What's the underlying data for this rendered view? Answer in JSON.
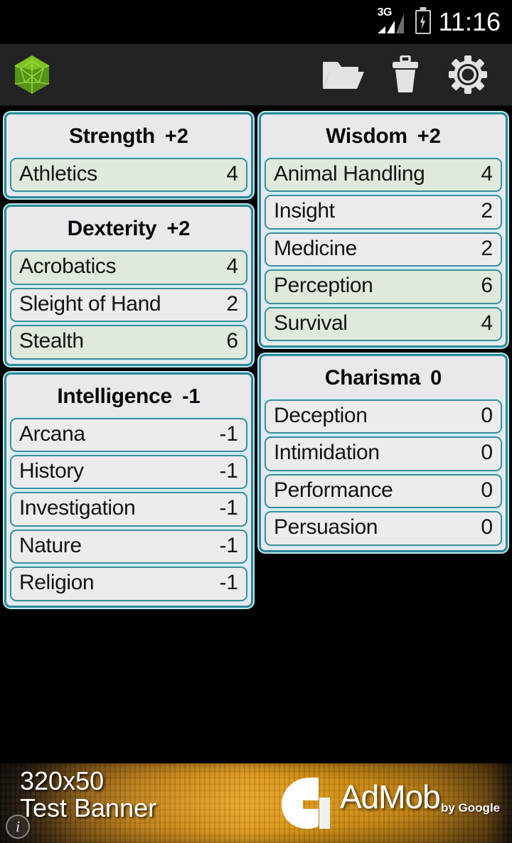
{
  "status_bar": {
    "network_label": "3G",
    "signal_icon": "signal-bars-icon",
    "battery_icon": "battery-charging-icon",
    "time": "11:16"
  },
  "action_bar": {
    "app_logo_icon": "d20-dice-icon",
    "app_logo_color": "#6aad1e",
    "buttons": [
      {
        "name": "open-folder-button",
        "icon": "folder-open-icon",
        "label": "Open"
      },
      {
        "name": "delete-button",
        "icon": "trash-icon",
        "label": "Delete"
      },
      {
        "name": "settings-button",
        "icon": "gear-icon",
        "label": "Settings"
      }
    ]
  },
  "theme": {
    "background": "#000000",
    "action_bar_bg": "#232323",
    "card_border": "#2c8a9a",
    "card_glow": "#bfe9f0",
    "card_header_bg": "#e9e8ec",
    "row_bg": "#edebeb",
    "row_proficient_bg": "#dfeadd",
    "row_border": "#3f8d9b",
    "text": "#141414"
  },
  "columns": [
    {
      "name": "left-column",
      "cards": [
        {
          "ability": "Strength",
          "modifier": "+2",
          "skills": [
            {
              "name": "Athletics",
              "value": "4",
              "proficient": true
            }
          ]
        },
        {
          "ability": "Dexterity",
          "modifier": "+2",
          "skills": [
            {
              "name": "Acrobatics",
              "value": "4",
              "proficient": true
            },
            {
              "name": "Sleight of Hand",
              "value": "2",
              "proficient": false
            },
            {
              "name": "Stealth",
              "value": "6",
              "proficient": true
            }
          ]
        },
        {
          "ability": "Intelligence",
          "modifier": "-1",
          "skills": [
            {
              "name": "Arcana",
              "value": "-1",
              "proficient": false
            },
            {
              "name": "History",
              "value": "-1",
              "proficient": false
            },
            {
              "name": "Investigation",
              "value": "-1",
              "proficient": false
            },
            {
              "name": "Nature",
              "value": "-1",
              "proficient": false
            },
            {
              "name": "Religion",
              "value": "-1",
              "proficient": false
            }
          ]
        }
      ]
    },
    {
      "name": "right-column",
      "cards": [
        {
          "ability": "Wisdom",
          "modifier": "+2",
          "skills": [
            {
              "name": "Animal Handling",
              "value": "4",
              "proficient": true
            },
            {
              "name": "Insight",
              "value": "2",
              "proficient": false
            },
            {
              "name": "Medicine",
              "value": "2",
              "proficient": false
            },
            {
              "name": "Perception",
              "value": "6",
              "proficient": true
            },
            {
              "name": "Survival",
              "value": "4",
              "proficient": true
            }
          ]
        },
        {
          "ability": "Charisma",
          "modifier": "0",
          "skills": [
            {
              "name": "Deception",
              "value": "0",
              "proficient": false
            },
            {
              "name": "Intimidation",
              "value": "0",
              "proficient": false
            },
            {
              "name": "Performance",
              "value": "0",
              "proficient": false
            },
            {
              "name": "Persuasion",
              "value": "0",
              "proficient": false
            }
          ]
        }
      ]
    }
  ],
  "ad_banner": {
    "size_text": "320x50",
    "title_text": "Test Banner",
    "brand": "AdMob",
    "byline": "by Google",
    "info_icon": "info-circle-icon",
    "logo_icon": "admob-logo-icon"
  }
}
